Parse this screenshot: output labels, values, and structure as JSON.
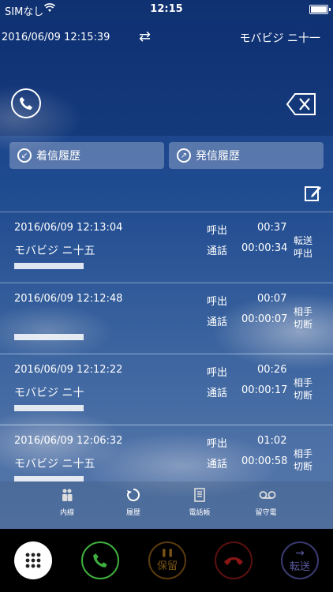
{
  "status": {
    "carrier": "SIMなし",
    "time": "12:15"
  },
  "header": {
    "datetime": "2016/06/09  12:15:39",
    "caller": "モバビジ ニ十一"
  },
  "tabs": [
    {
      "label": "着信履歴"
    },
    {
      "label": "発信履歴"
    }
  ],
  "history": [
    {
      "date": "2016/06/09 12:13:04",
      "name": "モバビジ ニ十五",
      "ring_label": "呼出",
      "ring": "00:37",
      "talk_label": "通話",
      "talk": "00:00:34",
      "status": "転送\n呼出"
    },
    {
      "date": "2016/06/09 12:12:48",
      "name": "",
      "ring_label": "呼出",
      "ring": "00:07",
      "talk_label": "通話",
      "talk": "00:00:07",
      "status": "相手\n切断"
    },
    {
      "date": "2016/06/09 12:12:22",
      "name": "モバビジ ニ十",
      "ring_label": "呼出",
      "ring": "00:26",
      "talk_label": "通話",
      "talk": "00:00:17",
      "status": "相手\n切断"
    },
    {
      "date": "2016/06/09 12:06:32",
      "name": "モバビジ ニ十五",
      "ring_label": "呼出",
      "ring": "01:02",
      "talk_label": "通話",
      "talk": "00:00:58",
      "status": "相手\n切断"
    }
  ],
  "nav": [
    {
      "label": "内線"
    },
    {
      "label": "履歴"
    },
    {
      "label": "電話帳"
    },
    {
      "label": "留守電"
    }
  ],
  "actions": {
    "hold": "保留",
    "transfer": "転送"
  },
  "colors": {
    "call": "#3fae3f",
    "end": "#5a1010",
    "hold": "#7a5515",
    "transfer": "#5a5aa0"
  }
}
